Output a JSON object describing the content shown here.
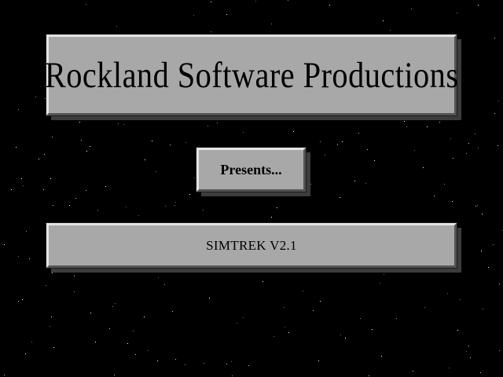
{
  "splash": {
    "title": "Rockland Software Productions",
    "presents": "Presents...",
    "version": "SIMTREK  V2.1"
  },
  "colors": {
    "background": "#000000",
    "panel_face": "#a8a8a8",
    "panel_highlight": "#e4e4e4",
    "panel_shadow": "#545454",
    "text": "#000000",
    "star": "#ffffff"
  }
}
